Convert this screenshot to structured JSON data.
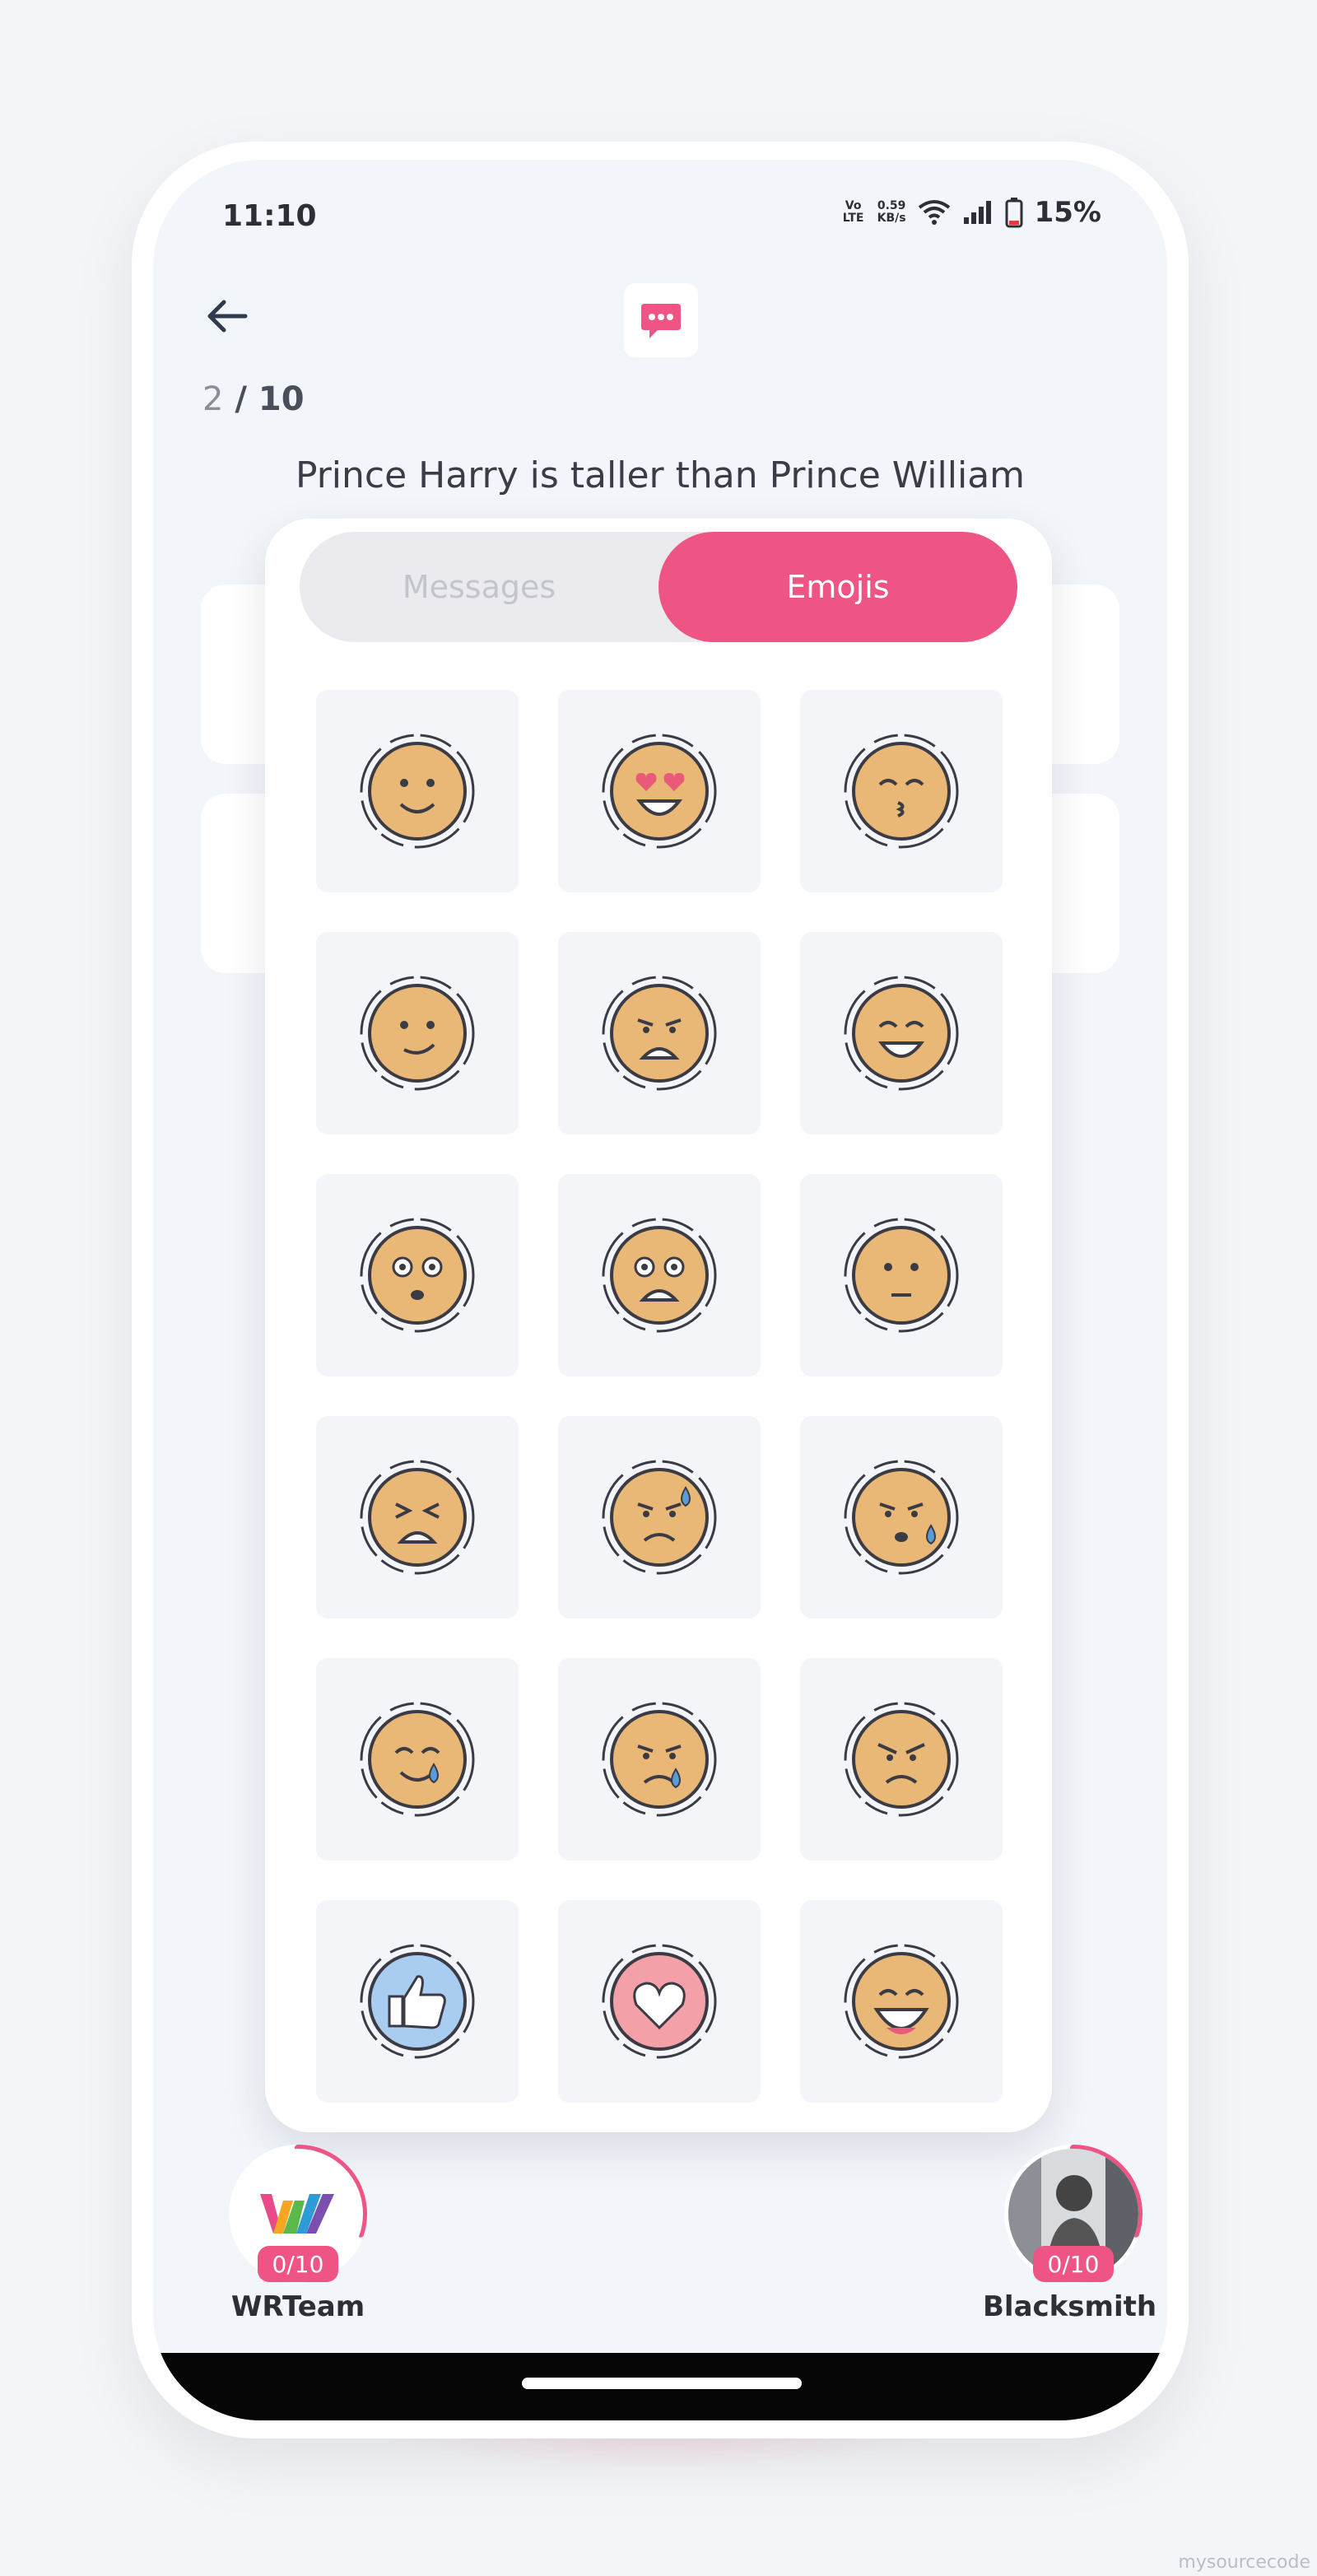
{
  "status_bar": {
    "time": "11:10",
    "volte": "Vo LTE",
    "speed_value": "0.59",
    "speed_unit": "KB/s",
    "battery": "15%"
  },
  "header": {
    "current": "2",
    "separator": " / ",
    "total": "10"
  },
  "question": "Prince Harry is taller than Prince William",
  "tabs": {
    "messages": "Messages",
    "emojis": "Emojis",
    "active": "emojis"
  },
  "emojis": [
    {
      "name": "smile-emoji"
    },
    {
      "name": "heart-eyes-emoji"
    },
    {
      "name": "kiss-emoji"
    },
    {
      "name": "smirk-emoji"
    },
    {
      "name": "anguished-emoji"
    },
    {
      "name": "grin-closed-eyes-emoji"
    },
    {
      "name": "astonished-emoji"
    },
    {
      "name": "frowning-open-mouth-emoji"
    },
    {
      "name": "upside-down-emoji"
    },
    {
      "name": "persevering-emoji"
    },
    {
      "name": "downcast-sweat-emoji"
    },
    {
      "name": "sad-sweat-emoji"
    },
    {
      "name": "crying-smile-emoji"
    },
    {
      "name": "crying-emoji"
    },
    {
      "name": "angry-emoji"
    },
    {
      "name": "thumbs-up-emoji"
    },
    {
      "name": "heart-emoji"
    },
    {
      "name": "laughing-emoji"
    }
  ],
  "players": [
    {
      "name": "WRTeam",
      "score": "0/10",
      "progress": 0.3,
      "logo": "WRTeam logo"
    },
    {
      "name": "Blacksmith ...",
      "score": "0/10",
      "progress": 0.3,
      "logo": "photo-avatar"
    }
  ],
  "colors": {
    "accent": "#ee5584",
    "background": "#f2f5f9",
    "emoji_skin": "#e9b877",
    "outline": "#3a3b44"
  },
  "watermark": "mysourcecode"
}
